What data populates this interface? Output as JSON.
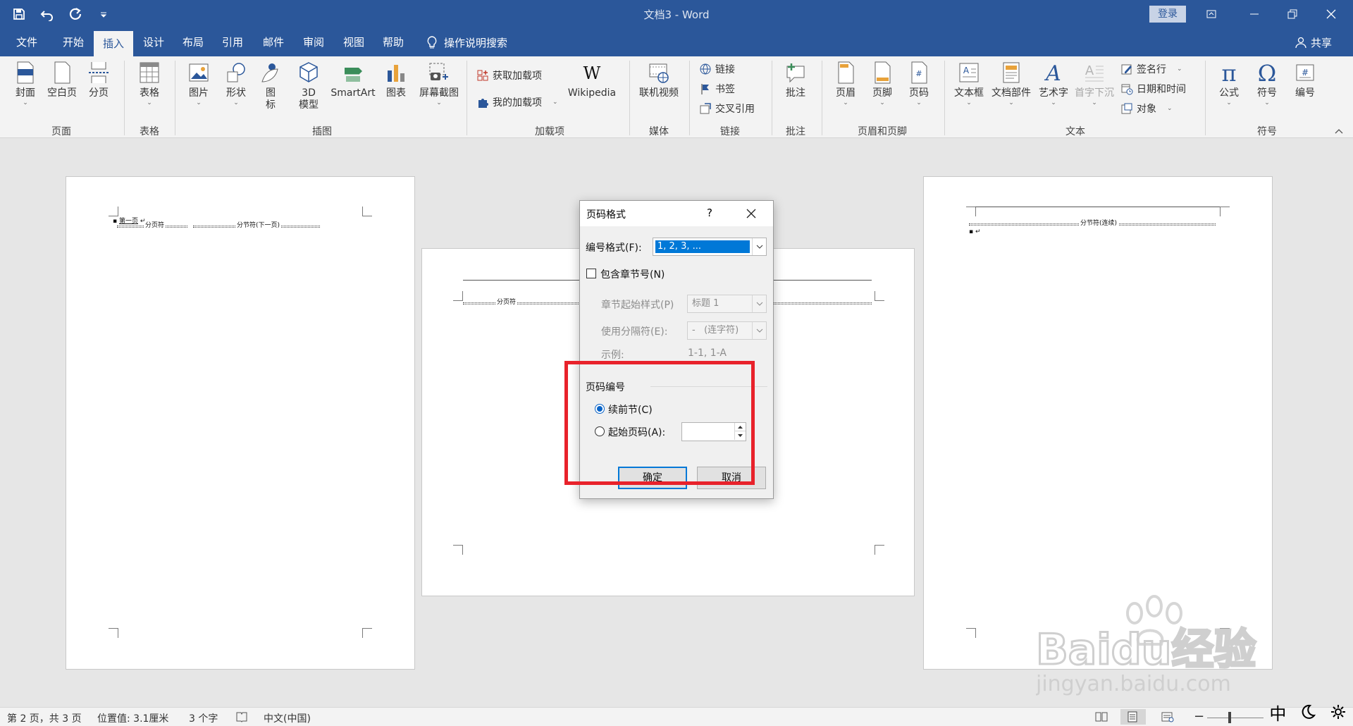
{
  "window": {
    "title": "文档3  -  Word",
    "login": "登录"
  },
  "tabs": [
    "文件",
    "开始",
    "插入",
    "设计",
    "布局",
    "引用",
    "邮件",
    "审阅",
    "视图",
    "帮助"
  ],
  "active_tab": "插入",
  "tell_me": "操作说明搜索",
  "share": "共享",
  "ribbon": {
    "page": {
      "cover": "封面",
      "blank": "空白页",
      "break": "分页",
      "group": "页面"
    },
    "table": {
      "table": "表格",
      "group": "表格"
    },
    "illustrations": {
      "picture": "图片",
      "shapes": "形状",
      "icons": "图\n标",
      "model3d": "3D\n模型",
      "smartart": "SmartArt",
      "chart": "图表",
      "screenshot": "屏幕截图",
      "group": "插图"
    },
    "addins": {
      "get": "获取加载项",
      "my": "我的加载项",
      "wikipedia": "Wikipedia",
      "group": "加载项"
    },
    "media": {
      "video": "联机视频",
      "group": "媒体"
    },
    "links": {
      "link": "链接",
      "bookmark": "书签",
      "crossref": "交叉引用",
      "group": "链接"
    },
    "comments": {
      "comment": "批注",
      "group": "批注"
    },
    "headerfooter": {
      "header": "页眉",
      "footer": "页脚",
      "pagenum": "页码",
      "group": "页眉和页脚"
    },
    "text": {
      "textbox": "文本框",
      "quickparts": "文档部件",
      "wordart": "艺术字",
      "dropcap": "首字下沉",
      "signature": "签名行",
      "datetime": "日期和时间",
      "object": "对象",
      "group": "文本"
    },
    "symbols": {
      "equation": "公式",
      "symbol": "符号",
      "number": "编号",
      "group": "符号"
    }
  },
  "document": {
    "page1": {
      "line1": "第一页",
      "pagebreak": "分页符",
      "sectionbreak": "分节符(下一页)"
    },
    "page2": {
      "pagebreak": "分页符"
    },
    "page3": {
      "sectionbreak": "分节符(连续)"
    }
  },
  "dialog": {
    "title": "页码格式",
    "help": "?",
    "format_label": "编号格式(F):",
    "format_value": "1, 2, 3, ...",
    "include_chapter": "包含章节号(N)",
    "include_chapter_checked": false,
    "chapter_style_label": "章节起始样式(P)",
    "chapter_style_value": "标题 1",
    "separator_label": "使用分隔符(E):",
    "separator_value": "-   (连字符)",
    "example_label": "示例:",
    "example_value": "1-1, 1-A",
    "numbering_group": "页码编号",
    "continue_label": "续前节(C)",
    "start_at_label": "起始页码(A):",
    "start_at_value": "",
    "selected_option": "continue",
    "ok": "确定",
    "cancel": "取消"
  },
  "statusbar": {
    "page": "第 2 页，共 3 页",
    "position": "位置值: 3.1厘米",
    "words": "3 个字",
    "language": "中文(中国)"
  },
  "ime": {
    "mode": "中"
  },
  "watermark": {
    "brand": "Baidu经验",
    "url": "jingyan.baidu.com"
  }
}
